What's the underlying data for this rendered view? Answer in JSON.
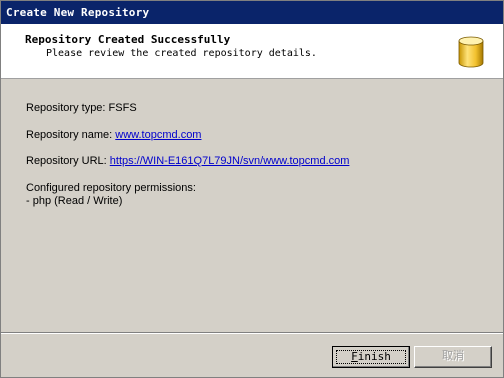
{
  "window": {
    "title": "Create New Repository"
  },
  "header": {
    "title": "Repository Created Successfully",
    "subtitle": "Please review the created repository details.",
    "icon": "database-icon"
  },
  "details": {
    "type_label": "Repository type:",
    "type_value": "FSFS",
    "name_label": "Repository name:",
    "name_value": "www.topcmd.com",
    "url_label": "Repository URL:",
    "url_value": "https://WIN-E161Q7L79JN/svn/www.topcmd.com",
    "permissions_label": "Configured repository permissions:",
    "permissions": [
      "- php (Read / Write)"
    ]
  },
  "buttons": {
    "finish_mnemonic": "F",
    "finish_rest": "inish",
    "cancel": "取消"
  },
  "colors": {
    "titlebar": "#0a246a",
    "link": "#0000cc",
    "window_bg": "#d4d0c8"
  }
}
